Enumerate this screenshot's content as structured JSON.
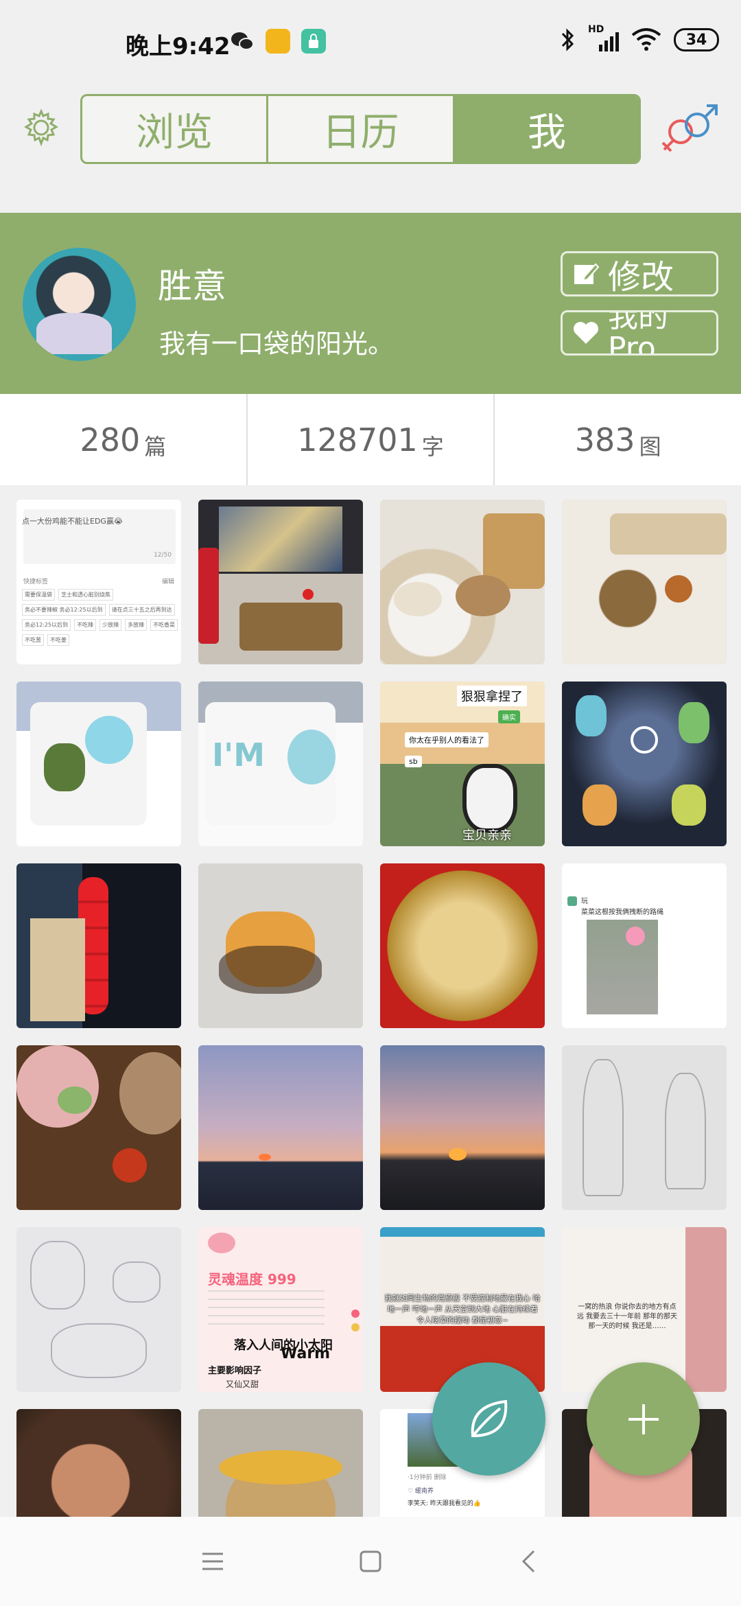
{
  "status_bar": {
    "time": "晚上9:42",
    "battery": "34",
    "network": "HD"
  },
  "tabs": [
    {
      "label": "浏览",
      "active": false
    },
    {
      "label": "日历",
      "active": false
    },
    {
      "label": "我",
      "active": true
    }
  ],
  "profile": {
    "name": "胜意",
    "motto": "我有一口袋的阳光。",
    "edit_label": "修改",
    "pro_label": "我的Pro"
  },
  "stats": [
    {
      "value": "280",
      "unit": "篇"
    },
    {
      "value": "128701",
      "unit": "字"
    },
    {
      "value": "383",
      "unit": "图"
    }
  ],
  "grid_text": {
    "t1_line1": "点一大份鸡能不能让EDG赢😭",
    "t1_count": "12/50",
    "t1_tags": "快捷标签",
    "t1_edit": "编辑",
    "t1_tag_a": "需要保温袋",
    "t1_tag_b": "芝士和透心脏别烧焦",
    "t1_tag_c": "务必不要辣椒 务必12:25以后到",
    "t1_tag_d": "请在点三十五之后再到达",
    "t1_tag_e": "务必12:25以后到",
    "t1_tag_f": "不吃辣",
    "t1_tag_g": "少放辣",
    "t1_tag_h": "多放辣",
    "t1_tag_i": "不吃香菜",
    "t1_tag_j": "不吃葱",
    "t1_tag_k": "不吃姜",
    "t7_top": "狠狠拿捏了",
    "t7_green": "确实",
    "t7_q": "你太在乎别人的看法了",
    "t7_sb": "sb",
    "t7_bottom": "宝贝亲亲",
    "t12_user": "玩",
    "t12_text": "菜菜这根按我俩拽断的路绳",
    "t18_line1": "灵魂温度 999",
    "t18_line2": "落入人间的小太阳",
    "t18_line3": "Warm",
    "t18_line4": "主要影响因子",
    "t18_line5": "又仙又甜",
    "t19_text": "我就如同生物的荒原般 不受控制地蔓在我心 哈地一声 哼地一声 从天空到大地 心脏在持续着令人眩晕的摆动 都是初恋~",
    "t20_text": "一窝的热浪 你说你去的地方有点远 我要去三十一年前 那年的那天 那一天的时候 我还是……",
    "t23_line1": "·1分钟前 删除",
    "t23_line2": "♡ 缓南养",
    "t23_line3": "李笑天: 昨天跟我看见的👍"
  },
  "colors": {
    "brand_green": "#8fae6c",
    "teal": "#53a8a1",
    "background": "#f0f0f0"
  },
  "icons": {
    "settings": "gear-icon",
    "gender": "gender-icon",
    "edit": "edit-icon",
    "heart": "heart-icon",
    "leaf": "leaf-icon",
    "add": "plus-icon"
  }
}
